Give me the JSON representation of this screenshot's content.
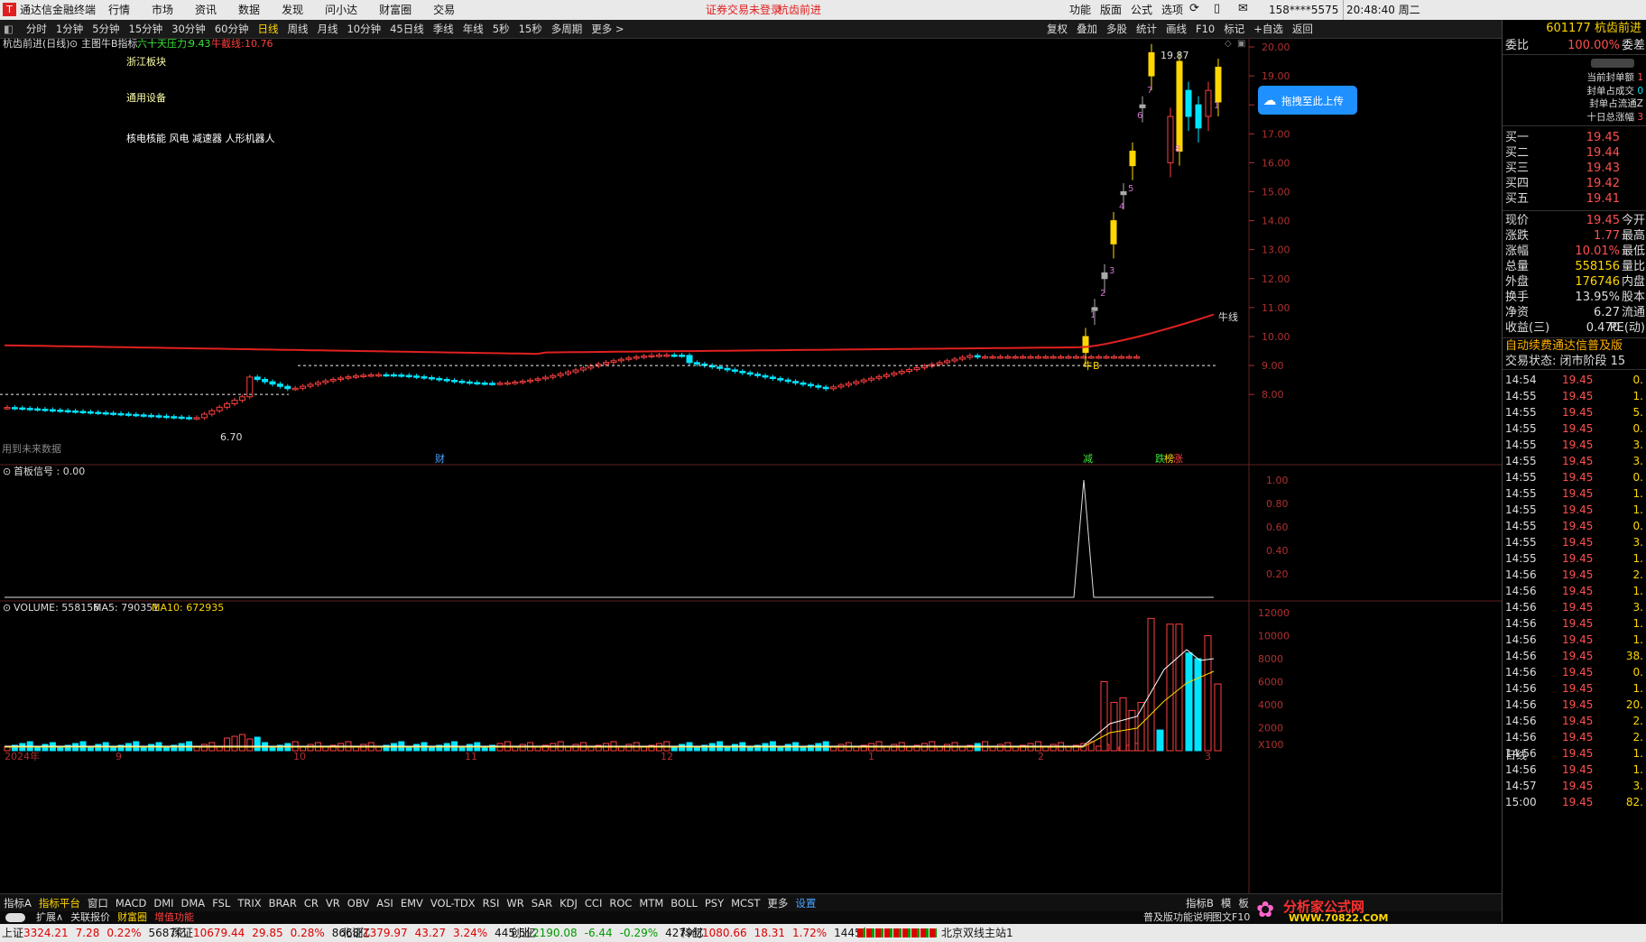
{
  "titlebar": {
    "app_title": "通达信金融终端",
    "menus": [
      "行情",
      "市场",
      "资讯",
      "数据",
      "发现",
      "问小达",
      "财富圈",
      "交易"
    ],
    "login_notice": "证券交易未登录",
    "stock_name": "杭齿前进",
    "right_menus": [
      "功能",
      "版面",
      "公式",
      "选项"
    ],
    "account": "158****5575",
    "clock": "20:48:40 周二"
  },
  "periods": {
    "items": [
      "分时",
      "1分钟",
      "5分钟",
      "15分钟",
      "30分钟",
      "60分钟",
      "日线",
      "周线",
      "月线",
      "10分钟",
      "45日线",
      "季线",
      "年线",
      "5秒",
      "15秒",
      "多周期",
      "更多 >"
    ],
    "selected": "日线",
    "right_items": [
      "复权",
      "叠加",
      "多股",
      "统计",
      "画线",
      "F10",
      "标记",
      "+自选",
      "返回"
    ]
  },
  "main_chart": {
    "header_name": "杭齿前进(日线)",
    "indicator_name": "主图牛B指标",
    "pressure_label": "六十天压力:",
    "pressure_value": "9.43",
    "niu_label": "牛截线:",
    "niu_value": "10.76",
    "notes": [
      "浙江板块",
      "通用设备",
      "核电核能 风电 减速器 人形机器人"
    ],
    "future_data_note": "用到未来数据",
    "high_label": "19.87",
    "low_label": "6.70",
    "niu_line_label": "牛线",
    "niu_b_label": "牛B",
    "markers": [
      {
        "text": "财",
        "color": "#4aa3ff"
      },
      {
        "text": "减",
        "color": "#39e639"
      },
      {
        "text": "跌",
        "color": "#39e639"
      },
      {
        "text": "榜",
        "color": "#ffd700"
      },
      {
        "text": "涨",
        "color": "#ff4040"
      }
    ],
    "yaxis": [
      "20.00",
      "19.00",
      "18.00",
      "17.00",
      "16.00",
      "15.00",
      "14.00",
      "13.00",
      "12.00",
      "11.00",
      "10.00",
      "9.00",
      "8.00"
    ],
    "count_labels": [
      "1",
      "2",
      "3",
      "4",
      "5",
      "6",
      "7",
      "8",
      "1",
      "1"
    ]
  },
  "signal_panel": {
    "title": "首板信号 : 0.00",
    "yaxis": [
      "1.00",
      "0.80",
      "0.60",
      "0.40",
      "0.20"
    ]
  },
  "volume_panel": {
    "volume_label": "VOLUME: 558156",
    "ma5_label": "MA5: 790351",
    "ma10_label": "MA10: 672935",
    "yaxis": [
      "12000",
      "10000",
      "8000",
      "6000",
      "4000",
      "2000",
      "X100"
    ],
    "xaxis": [
      "2024年",
      "9",
      "10",
      "11",
      "12",
      "1",
      "2",
      "3"
    ]
  },
  "right_panel": {
    "code": "601177",
    "name": "杭齿前进",
    "weibi_label": "委比",
    "weibi_value": "100.00%",
    "weicha_label": "委差",
    "seal_info": [
      "当前封单额",
      "封单占成交",
      "封单占流通Z",
      "十日总涨幅"
    ],
    "seal_values": [
      "1",
      "0",
      "",
      "3"
    ],
    "upload_label": "拖拽至此上传",
    "bids": [
      {
        "label": "买一",
        "price": "19.45"
      },
      {
        "label": "买二",
        "price": "19.44"
      },
      {
        "label": "买三",
        "price": "19.43"
      },
      {
        "label": "买四",
        "price": "19.42"
      },
      {
        "label": "买五",
        "price": "19.41"
      }
    ],
    "stats": [
      {
        "k": "现价",
        "v": "19.45",
        "t": "今开"
      },
      {
        "k": "涨跌",
        "v": "1.77",
        "t": "最高"
      },
      {
        "k": "涨幅",
        "v": "10.01%",
        "t": "最低"
      },
      {
        "k": "总量",
        "v": "558156",
        "t": "量比"
      },
      {
        "k": "外盘",
        "v": "176746",
        "t": "内盘"
      },
      {
        "k": "换手",
        "v": "13.95%",
        "t": "股本"
      },
      {
        "k": "净资",
        "v": "6.27",
        "t": "流通"
      },
      {
        "k": "收益(三)",
        "v": "0.470",
        "t": "PE(动)"
      }
    ],
    "promo": "自动续费通达信普及版",
    "trade_state": "交易状态: 闭市阶段 15",
    "ticks": [
      {
        "t": "14:54",
        "p": "19.45",
        "v": "0."
      },
      {
        "t": "14:55",
        "p": "19.45",
        "v": "1."
      },
      {
        "t": "14:55",
        "p": "19.45",
        "v": "5."
      },
      {
        "t": "14:55",
        "p": "19.45",
        "v": "0."
      },
      {
        "t": "14:55",
        "p": "19.45",
        "v": "3."
      },
      {
        "t": "14:55",
        "p": "19.45",
        "v": "3."
      },
      {
        "t": "14:55",
        "p": "19.45",
        "v": "0."
      },
      {
        "t": "14:55",
        "p": "19.45",
        "v": "1."
      },
      {
        "t": "14:55",
        "p": "19.45",
        "v": "1."
      },
      {
        "t": "14:55",
        "p": "19.45",
        "v": "0."
      },
      {
        "t": "14:55",
        "p": "19.45",
        "v": "3."
      },
      {
        "t": "14:55",
        "p": "19.45",
        "v": "1."
      },
      {
        "t": "14:56",
        "p": "19.45",
        "v": "2."
      },
      {
        "t": "14:56",
        "p": "19.45",
        "v": "1."
      },
      {
        "t": "14:56",
        "p": "19.45",
        "v": "3."
      },
      {
        "t": "14:56",
        "p": "19.45",
        "v": "1."
      },
      {
        "t": "14:56",
        "p": "19.45",
        "v": "1."
      },
      {
        "t": "14:56",
        "p": "19.45",
        "v": "38."
      },
      {
        "t": "14:56",
        "p": "19.45",
        "v": "0."
      },
      {
        "t": "14:56",
        "p": "19.45",
        "v": "1."
      },
      {
        "t": "14:56",
        "p": "19.45",
        "v": "20."
      },
      {
        "t": "14:56",
        "p": "19.45",
        "v": "2."
      },
      {
        "t": "14:56",
        "p": "19.45",
        "v": "2."
      },
      {
        "t": "14:56",
        "p": "19.45",
        "v": "1."
      },
      {
        "t": "14:56",
        "p": "19.45",
        "v": "1."
      },
      {
        "t": "14:57",
        "p": "19.45",
        "v": "3."
      },
      {
        "t": "15:00",
        "p": "19.45",
        "v": "82."
      }
    ],
    "period_label": "日线"
  },
  "bottom_tabs": {
    "items": [
      "指标A",
      "指标平台",
      "窗口",
      "MACD",
      "DMI",
      "DMA",
      "FSL",
      "TRIX",
      "BRAR",
      "CR",
      "VR",
      "OBV",
      "ASI",
      "EMV",
      "VOL-TDX",
      "RSI",
      "WR",
      "SAR",
      "KDJ",
      "CCI",
      "ROC",
      "MTM",
      "BOLL",
      "PSY",
      "MCST",
      "更多",
      "设置"
    ],
    "right_items": [
      "指标B",
      "模",
      "板"
    ],
    "row2": [
      "扩展∧",
      "关联报价",
      "财富圈",
      "增值功能"
    ],
    "help": "普及版功能说明",
    "help2": "图文F10",
    "watermark": "分析家公式网",
    "watermark_url": "WWW.70822.COM"
  },
  "statusbar": {
    "items": [
      {
        "name": "上证",
        "val": "3324.21",
        "chg": "7.28",
        "pct": "0.22%",
        "amt": "5687亿"
      },
      {
        "name": "深证",
        "val": "10679.44",
        "chg": "29.85",
        "pct": "0.28%",
        "amt": "8668亿"
      },
      {
        "name": "北证",
        "val": "1379.97",
        "chg": "43.27",
        "pct": "3.24%",
        "amt": "445.5亿"
      },
      {
        "name": "创业",
        "val": "2190.08",
        "chg": "-6.44",
        "pct": "-0.29%",
        "amt": "4279亿"
      },
      {
        "name": "科创",
        "val": "1080.66",
        "chg": "18.31",
        "pct": "1.72%",
        "amt": "1445亿"
      }
    ],
    "server": "北京双线主站1"
  },
  "colors": {
    "up": "#ff4040",
    "down": "#00e5ff",
    "niu_line": "#e02020",
    "accent_yellow": "#ffd700"
  }
}
